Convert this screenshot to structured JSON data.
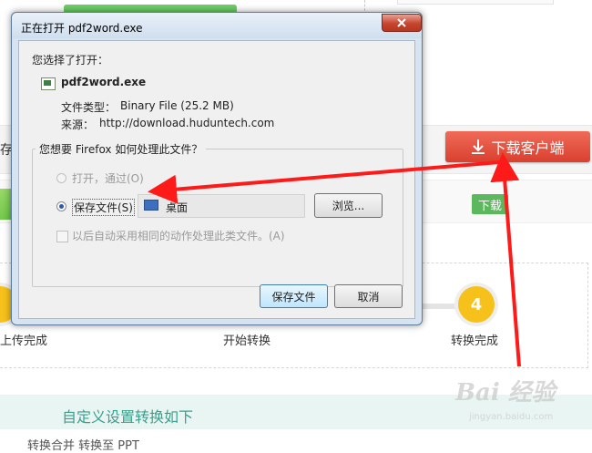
{
  "background": {
    "band_left_text": "存大",
    "download_client_label": "下载客户端",
    "row_download_label": "下载",
    "steps": [
      {
        "number": "",
        "label": "上传完成"
      },
      {
        "number": "",
        "label": "开始转换"
      },
      {
        "number": "4",
        "label": "转换完成"
      }
    ],
    "custom_settings_text": "自定义设置转换如下",
    "bottom_text": "转换合并        转换至 PPT",
    "watermark": "Bai 经验",
    "watermark_sub": "jingyan.baidu.com",
    "colors": {
      "accent_red": "#d9402f",
      "step_yellow": "#f6c11a",
      "green": "#5cb85c",
      "teal": "#3aa08c"
    }
  },
  "dialog": {
    "title": "正在打开 pdf2word.exe",
    "you_chose": "您选择了打开：",
    "file_name": "pdf2word.exe",
    "type_label": "文件类型：",
    "type_value": "Binary File (25.2 MB)",
    "from_label": "来源：",
    "from_value": "http://download.huduntech.com",
    "question": "您想要 Firefox 如何处理此文件？",
    "open_with_label": "打开，通过(O)",
    "save_file_label": "保存文件(S)",
    "destination": "桌面",
    "browse_label": "浏览...",
    "auto_label": "以后自动采用相同的动作处理此类文件。(A)",
    "save_button": "保存文件",
    "cancel_button": "取消",
    "icons": [
      "application-file-icon",
      "desktop-icon",
      "close-icon"
    ]
  }
}
